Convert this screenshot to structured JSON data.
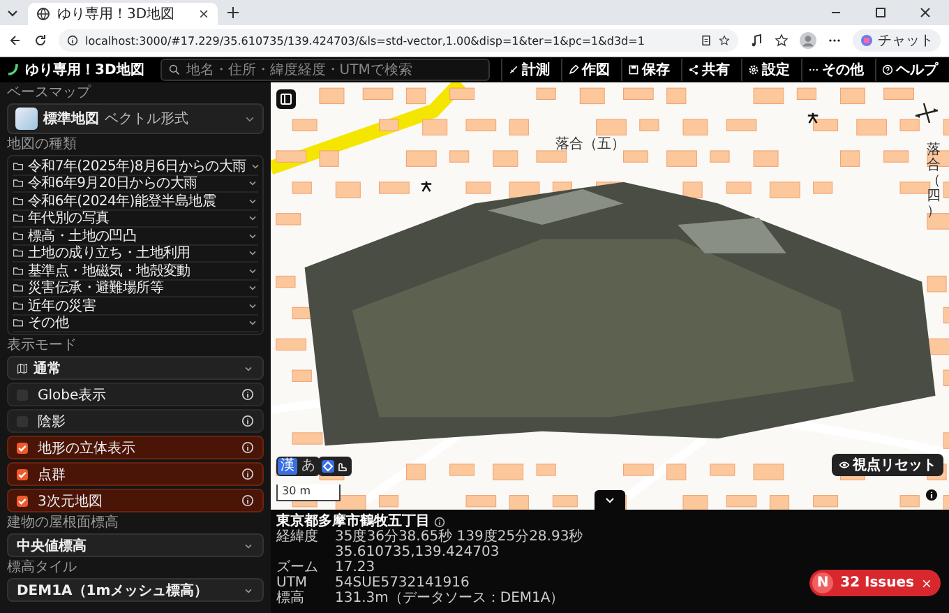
{
  "browser": {
    "tab_title": "ゆり専用！3D地図",
    "url": "localhost:3000/#17.229/35.610735/139.424703/&ls=std-vector,1.00&disp=1&ter=1&pc=1&d3d=1",
    "copilot_label": "チャット"
  },
  "header": {
    "title": "ゆり専用！3D地図",
    "search_placeholder": "地名・住所・緯度経度・UTMで検索",
    "tools": [
      {
        "kind": "measure",
        "label": "計測"
      },
      {
        "kind": "draw",
        "label": "作図"
      },
      {
        "kind": "save",
        "label": "保存"
      },
      {
        "kind": "share",
        "label": "共有"
      },
      {
        "kind": "settings",
        "label": "設定"
      },
      {
        "kind": "more",
        "label": "その他"
      },
      {
        "kind": "help",
        "label": "ヘルプ"
      }
    ]
  },
  "sidebar": {
    "basemap_heading": "ベースマップ",
    "basemap": {
      "name": "標準地図",
      "format": "ベクトル形式"
    },
    "map_types_heading": "地図の種類",
    "map_types": [
      "令和7年(2025年)8月6日からの大雨",
      "令和6年9月20日からの大雨",
      "令和6年(2024年)能登半島地震",
      "年代別の写真",
      "標高・土地の凹凸",
      "土地の成り立ち・土地利用",
      "基準点・地磁気・地殻変動",
      "災害伝承・避難場所等",
      "近年の災害",
      "その他"
    ],
    "display_mode_heading": "表示モード",
    "display_mode": "通常",
    "toggles": [
      {
        "label": "Globe表示",
        "checked": false
      },
      {
        "label": "陰影",
        "checked": false
      },
      {
        "label": "地形の立体表示",
        "checked": true
      },
      {
        "label": "点群",
        "checked": true
      },
      {
        "label": "3次元地図",
        "checked": true
      }
    ],
    "building_heading": "建物の屋根面標高",
    "building_value": "中央値標高",
    "elevation_tile_heading": "標高タイル",
    "elevation_tile_value": "DEM1A（1mメッシュ標高）"
  },
  "map": {
    "labels": [
      {
        "text": "落合（五）",
        "kind": "horizontal"
      },
      {
        "text": "落合（四）",
        "kind": "vertical"
      }
    ],
    "input_modes": [
      {
        "label": "漢",
        "selected": true
      },
      {
        "label": "あ",
        "selected": false
      }
    ],
    "scale": "30 m",
    "reset_button": "視点リセット"
  },
  "info": {
    "place": "東京都多摩市鶴牧五丁目",
    "rows": [
      {
        "label": "経緯度",
        "values": [
          "35度36分38.65秒 139度25分28.93秒",
          "35.610735,139.424703"
        ]
      },
      {
        "label": "ズーム",
        "values": [
          "17.23"
        ]
      },
      {
        "label": "UTM",
        "values": [
          "54SUE5732141916"
        ]
      },
      {
        "label": "標高",
        "values": [
          "131.3m（データソース：DEM1A）"
        ]
      }
    ]
  },
  "issues": {
    "logo": "N",
    "label": "32 Issues"
  }
}
